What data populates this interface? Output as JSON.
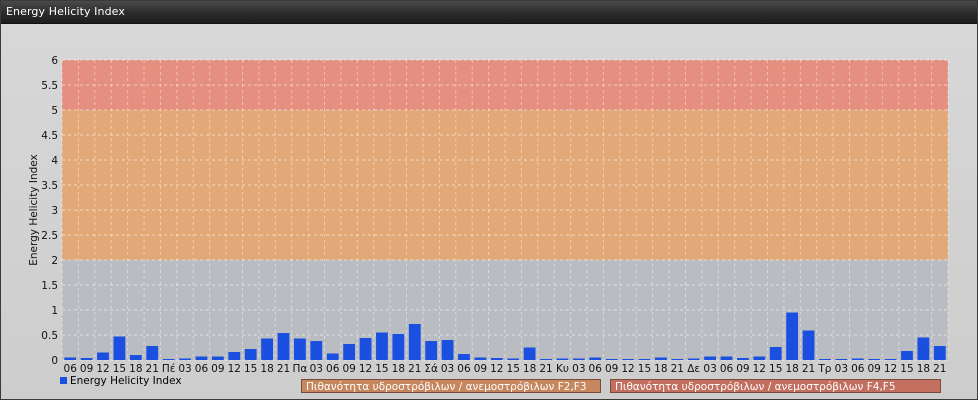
{
  "window": {
    "title": "Energy Helicity Index"
  },
  "chart_data": {
    "type": "bar",
    "title": "",
    "xlabel": "",
    "ylabel": "Energy Helicity Index",
    "ylim": [
      0,
      6
    ],
    "yticks": [
      "0",
      "0.5",
      "1",
      "1.5",
      "2",
      "2.5",
      "3",
      "3.5",
      "4",
      "4.5",
      "5",
      "5.5",
      "6"
    ],
    "grid": true,
    "legend_placement": "bottom-left",
    "bands": [
      {
        "from": 0,
        "to": 2,
        "color": "#b9bdc2"
      },
      {
        "from": 2,
        "to": 5,
        "color": "#e2a878",
        "label": "Πιθανότητα υδροστρόβιλων / ανεμοστρόβιλων F2,F3"
      },
      {
        "from": 5,
        "to": 6,
        "color": "#e48f80",
        "label": "Πιθανότητα υδροστρόβιλων / ανεμοστρόβιλων F4,F5"
      }
    ],
    "categories": [
      "06",
      "09",
      "12",
      "15",
      "18",
      "21",
      "Πέ",
      "03",
      "06",
      "09",
      "12",
      "15",
      "18",
      "21",
      "Πα",
      "03",
      "06",
      "09",
      "12",
      "15",
      "18",
      "21",
      "Σά",
      "03",
      "06",
      "09",
      "12",
      "15",
      "18",
      "21",
      "Κυ",
      "03",
      "06",
      "09",
      "12",
      "15",
      "18",
      "21",
      "Δε",
      "03",
      "06",
      "09",
      "12",
      "15",
      "18",
      "21",
      "Τρ",
      "03",
      "06",
      "09",
      "12",
      "15",
      "18",
      "21"
    ],
    "series": [
      {
        "name": "Energy Helicity Index",
        "color": "#1a4fe0",
        "values": [
          0.05,
          0.04,
          0.15,
          0.47,
          0.1,
          0.28,
          0.02,
          0.03,
          0.07,
          0.07,
          0.16,
          0.22,
          0.43,
          0.54,
          0.43,
          0.38,
          0.13,
          0.32,
          0.44,
          0.55,
          0.52,
          0.72,
          0.38,
          0.4,
          0.12,
          0.05,
          0.04,
          0.03,
          0.25,
          0.02,
          0.03,
          0.03,
          0.05,
          0.02,
          0.02,
          0.02,
          0.05,
          0.02,
          0.03,
          0.07,
          0.07,
          0.04,
          0.07,
          0.26,
          0.95,
          0.59,
          0.02,
          0.02,
          0.03,
          0.02,
          0.02,
          0.18,
          0.45,
          0.28
        ]
      }
    ],
    "legend": {
      "series_label": "Energy Helicity Index"
    }
  }
}
